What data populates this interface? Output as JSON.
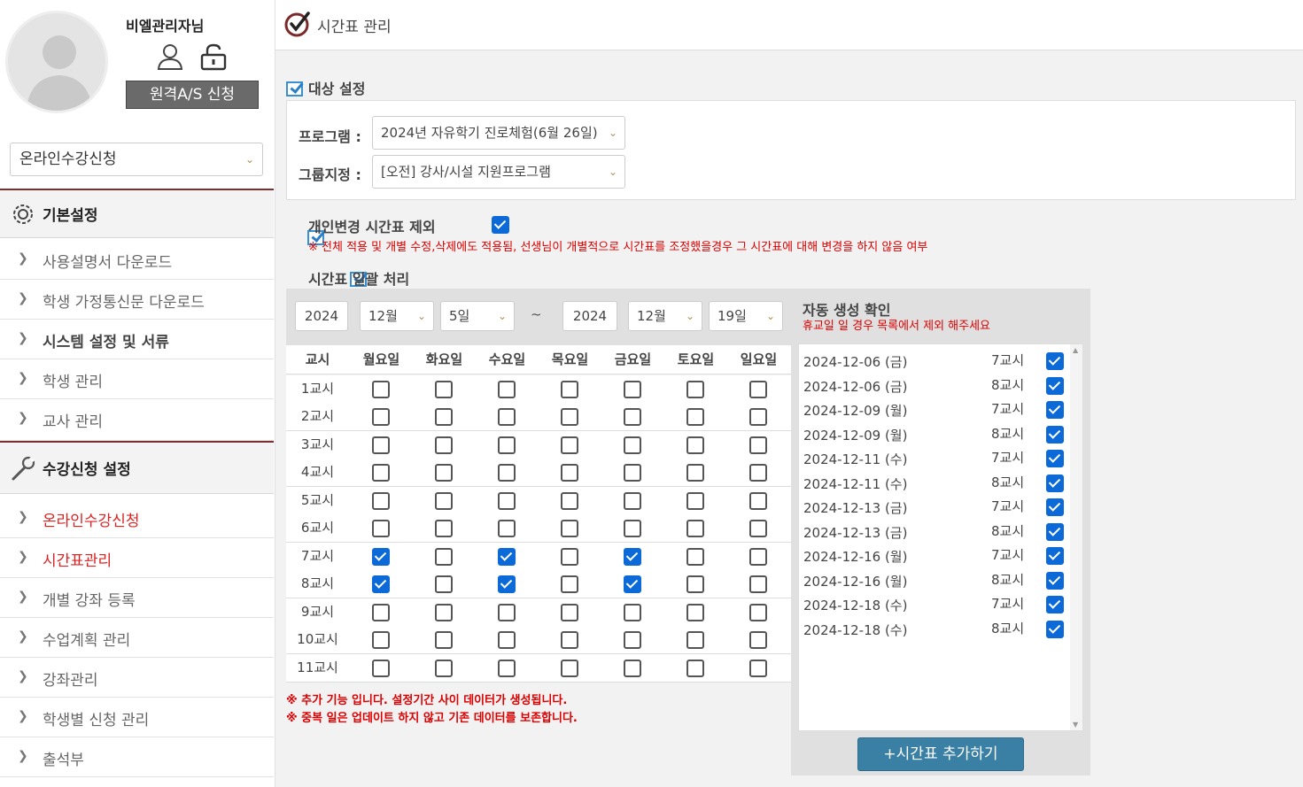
{
  "user": {
    "name": "비엘관리자님",
    "as_button": "원격A/S 신청"
  },
  "side_select": {
    "value": "온라인수강신청"
  },
  "sections": [
    {
      "title": "기본설정",
      "items": [
        "사용설명서 다운로드",
        "학생 가정통신문 다운로드",
        "시스템 설정 및 서류",
        "학생 관리",
        "교사 관리"
      ]
    },
    {
      "title": "수강신청 설정",
      "items": [
        "온라인수강신청",
        "시간표관리",
        "개별 강좌 등록",
        "수업계획 관리",
        "강좌관리",
        "학생별 신청 관리",
        "출석부"
      ]
    }
  ],
  "page": {
    "title": "시간표 관리"
  },
  "target": {
    "heading": "대상 설정",
    "program_label": "프로그램 :",
    "program_value": "2024년 자유학기 진로체험(6월 26일)",
    "group_label": "그룹지정 :",
    "group_value": "[오전] 강사/시설 지원프로그램"
  },
  "exclude": {
    "label": "개인변경 시간표 제외",
    "checked": true,
    "note": "※ 전체 적용 및 개별 수정,삭제에도 적용됨, 선생님이 개별적으로 시간표를 조정했을경우 그 시간표에 대해 변경을 하지 않음 여부"
  },
  "batch": {
    "heading": "시간표 일괄 처리",
    "start": {
      "year": "2024",
      "month": "12월",
      "day": "5일"
    },
    "tilde": "~",
    "end": {
      "year": "2024",
      "month": "12월",
      "day": "19일"
    },
    "columns": [
      "교시",
      "월요일",
      "화요일",
      "수요일",
      "목요일",
      "금요일",
      "토요일",
      "일요일"
    ],
    "periods": [
      "1교시",
      "2교시",
      "3교시",
      "4교시",
      "5교시",
      "6교시",
      "7교시",
      "8교시",
      "9교시",
      "10교시",
      "11교시"
    ],
    "checked": {
      "7교시": [
        0,
        2,
        4
      ],
      "8교시": [
        0,
        2,
        4
      ]
    },
    "notes": [
      "※ 추가 기능 입니다. 설정기간 사이 데이터가 생성됩니다.",
      "※ 중복 일은 업데이트 하지 않고 기존 데이터를 보존합니다."
    ]
  },
  "auto": {
    "title": "자동 생성 확인",
    "subtitle": "휴교일 일 경우 목록에서 제외 해주세요",
    "rows": [
      {
        "date": "2024-12-06 (금)",
        "period": "7교시"
      },
      {
        "date": "2024-12-06 (금)",
        "period": "8교시"
      },
      {
        "date": "2024-12-09 (월)",
        "period": "7교시"
      },
      {
        "date": "2024-12-09 (월)",
        "period": "8교시"
      },
      {
        "date": "2024-12-11 (수)",
        "period": "7교시"
      },
      {
        "date": "2024-12-11 (수)",
        "period": "8교시"
      },
      {
        "date": "2024-12-13 (금)",
        "period": "7교시"
      },
      {
        "date": "2024-12-13 (금)",
        "period": "8교시"
      },
      {
        "date": "2024-12-16 (월)",
        "period": "7교시"
      },
      {
        "date": "2024-12-16 (월)",
        "period": "8교시"
      },
      {
        "date": "2024-12-18 (수)",
        "period": "7교시"
      },
      {
        "date": "2024-12-18 (수)",
        "period": "8교시"
      }
    ],
    "add_button": "+시간표 추가하기"
  },
  "icons": [
    "user-icon",
    "unlock-icon",
    "gear-icon",
    "wrench-icon",
    "check-circle-icon",
    "chevron-right-icon",
    "chevron-down-icon",
    "checkbox-icon"
  ],
  "colors": {
    "accent": "#7a3030",
    "active": "#d22222",
    "check": "#0b6ad8",
    "button": "#3a7fa4"
  }
}
